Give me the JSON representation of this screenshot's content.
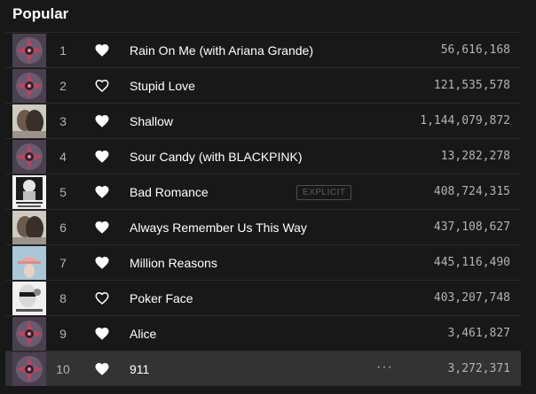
{
  "section": {
    "title": "Popular"
  },
  "tracks": [
    {
      "number": "1",
      "title": "Rain On Me (with Ariana Grande)",
      "plays": "56,616,168",
      "liked": true,
      "art": "chromatica"
    },
    {
      "number": "2",
      "title": "Stupid Love",
      "plays": "121,535,578",
      "liked": false,
      "art": "chromatica"
    },
    {
      "number": "3",
      "title": "Shallow",
      "plays": "1,144,079,872",
      "liked": true,
      "art": "star-is-born"
    },
    {
      "number": "4",
      "title": "Sour Candy (with BLACKPINK)",
      "plays": "13,282,278",
      "liked": true,
      "art": "chromatica"
    },
    {
      "number": "5",
      "title": "Bad Romance",
      "plays": "408,724,315",
      "liked": true,
      "art": "fame-monster",
      "badge": "EXPLICIT"
    },
    {
      "number": "6",
      "title": "Always Remember Us This Way",
      "plays": "437,108,627",
      "liked": true,
      "art": "star-is-born"
    },
    {
      "number": "7",
      "title": "Million Reasons",
      "plays": "445,116,490",
      "liked": true,
      "art": "joanne"
    },
    {
      "number": "8",
      "title": "Poker Face",
      "plays": "403,207,748",
      "liked": false,
      "art": "the-fame"
    },
    {
      "number": "9",
      "title": "Alice",
      "plays": "3,461,827",
      "liked": true,
      "art": "chromatica"
    },
    {
      "number": "10",
      "title": "911",
      "plays": "3,272,371",
      "liked": true,
      "art": "chromatica",
      "hovered": true,
      "more": "···"
    }
  ],
  "colors": {
    "background": "#181818",
    "row_hover": "#333333",
    "text_primary": "#ffffff",
    "text_secondary": "#b3b3b3",
    "divider": "#2a2a2a"
  },
  "icons": {
    "liked": "heart-filled-icon",
    "not_liked": "heart-outline-icon",
    "more": "more-options-icon"
  }
}
